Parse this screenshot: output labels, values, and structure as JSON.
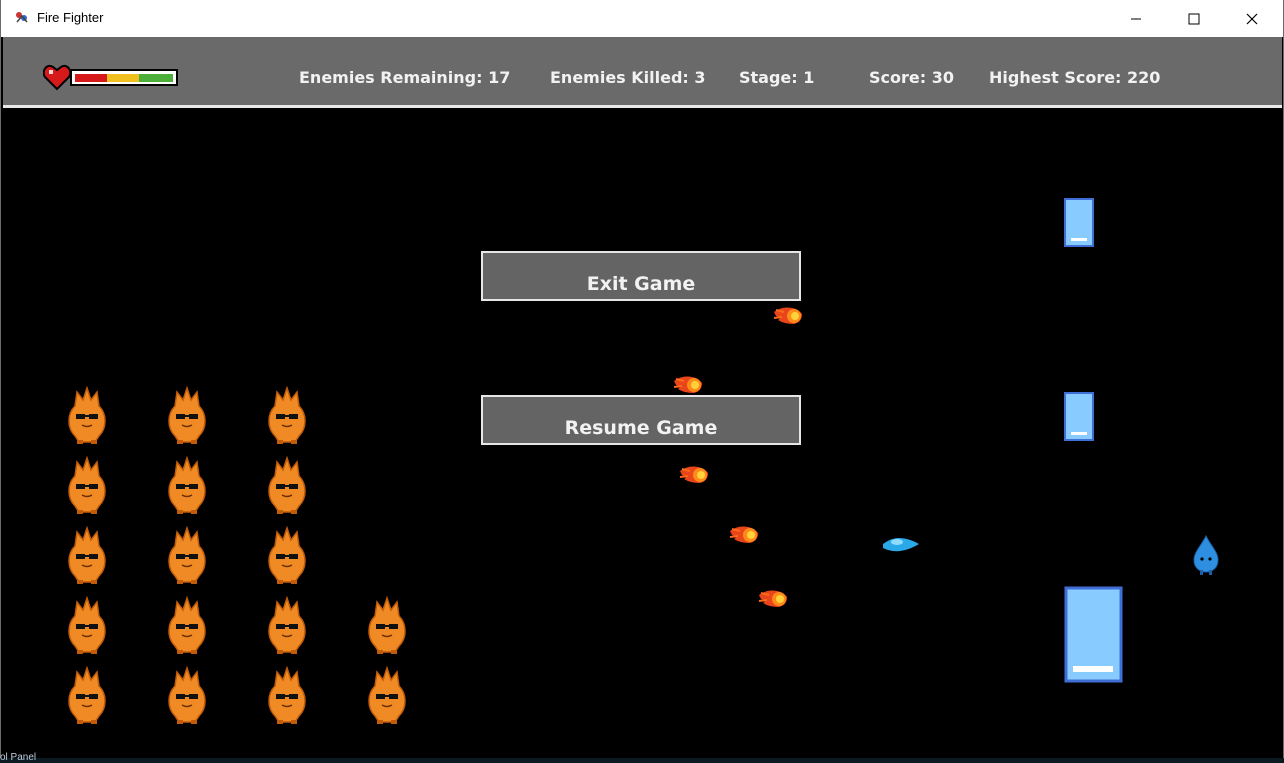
{
  "window": {
    "title": "Fire Fighter",
    "icon": "app-icon"
  },
  "hud": {
    "enemies_remaining": "Enemies Remaining: 17",
    "enemies_killed": "Enemies Killed: 3",
    "stage": "Stage: 1",
    "score": "Score: 30",
    "highest_score": "Highest Score: 220",
    "health_icon": "heart-icon",
    "health_bar_colors": [
      "#d61a1a",
      "#f0c020",
      "#4caf3a"
    ]
  },
  "menu": {
    "exit_label": "Exit Game",
    "resume_label": "Resume Game"
  },
  "scene": {
    "fire_enemy_rows": [
      3,
      3,
      3,
      4,
      4
    ],
    "fireballs": 5,
    "ice_barriers": 3,
    "player": "water-drop",
    "water_projectile": "water-shot"
  },
  "background_label": "ol Panel"
}
